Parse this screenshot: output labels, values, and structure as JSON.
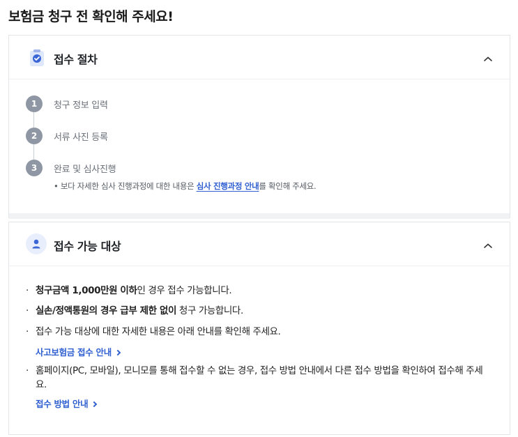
{
  "page_title": "보험금 청구 전 확인해 주세요!",
  "procedure": {
    "title": "접수 절차",
    "icon": "clipboard-check-icon",
    "steps": [
      {
        "number": "1",
        "label": "청구 정보 입력"
      },
      {
        "number": "2",
        "label": "서류 사진 등록"
      },
      {
        "number": "3",
        "label": "완료 및 심사진행"
      }
    ],
    "note_prefix": "• 보다 자세한 심사 진행과정에 대한 내용은 ",
    "note_link": "심사 진행과정 안내",
    "note_suffix": "를 확인해 주세요."
  },
  "eligibility": {
    "title": "접수 가능 대상",
    "icon": "person-icon",
    "bullet1": {
      "bold": "청구금액 1,000만원 이하",
      "rest": "인 경우 접수 가능합니다."
    },
    "bullet2": {
      "bold": "실손/정액통원의 경우 급부 제한 없이",
      "rest": " 청구 가능합니다."
    },
    "bullet3": "접수 가능 대상에 대한 자세한 내용은 아래 안내를 확인해 주세요.",
    "link1": "사고보험금 접수 안내",
    "bullet4": "홈페이지(PC, 모바일), 모니모를 통해 접수할 수 없는 경우, 접수 방법 안내에서 다른 접수 방법을 확인하여 접수해 주세요.",
    "link2": "접수 방법 안내"
  },
  "colors": {
    "accent": "#2f5fd0",
    "step_circle": "#8e97a3",
    "icon_bg": "#e8eefc"
  }
}
